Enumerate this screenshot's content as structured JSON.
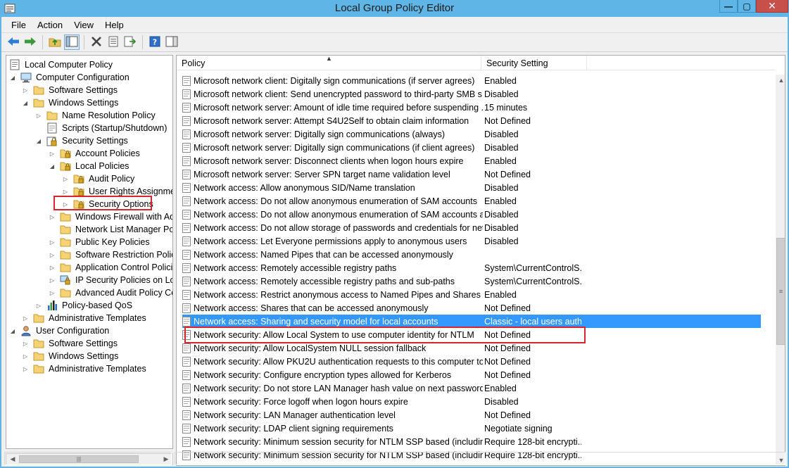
{
  "window": {
    "title": "Local Group Policy Editor"
  },
  "menubar": [
    {
      "label": "File"
    },
    {
      "label": "Action"
    },
    {
      "label": "View"
    },
    {
      "label": "Help"
    }
  ],
  "toolbar": [
    {
      "icon": "back-arrow-icon"
    },
    {
      "icon": "forward-arrow-icon"
    },
    {
      "icon": "up-folder-icon"
    },
    {
      "icon": "show-hide-tree-icon"
    },
    {
      "icon": "delete-icon"
    },
    {
      "icon": "properties-icon"
    },
    {
      "icon": "export-list-icon"
    },
    {
      "icon": "help-icon"
    },
    {
      "icon": "show-action-pane-icon"
    }
  ],
  "tree": [
    {
      "label": "Local Computer Policy",
      "level": 0,
      "expander": "",
      "icon": "policy"
    },
    {
      "label": "Computer Configuration",
      "level": 0,
      "expander": "open",
      "icon": "computer"
    },
    {
      "label": "Software Settings",
      "level": 1,
      "expander": "closed",
      "icon": "folder"
    },
    {
      "label": "Windows Settings",
      "level": 1,
      "expander": "open",
      "icon": "folder"
    },
    {
      "label": "Name Resolution Policy",
      "level": 2,
      "expander": "closed",
      "icon": "folder"
    },
    {
      "label": "Scripts (Startup/Shutdown)",
      "level": 2,
      "expander": "",
      "icon": "script"
    },
    {
      "label": "Security Settings",
      "level": 2,
      "expander": "open",
      "icon": "security"
    },
    {
      "label": "Account Policies",
      "level": 3,
      "expander": "closed",
      "icon": "lockfolder"
    },
    {
      "label": "Local Policies",
      "level": 3,
      "expander": "open",
      "icon": "lockfolder"
    },
    {
      "label": "Audit Policy",
      "level": 4,
      "expander": "closed",
      "icon": "lockfolder"
    },
    {
      "label": "User Rights Assignment",
      "level": 4,
      "expander": "closed",
      "icon": "lockfolder"
    },
    {
      "label": "Security Options",
      "level": 4,
      "expander": "closed",
      "icon": "lockfolder",
      "highlighted": true
    },
    {
      "label": "Windows Firewall with Adv",
      "level": 3,
      "expander": "closed",
      "icon": "folder"
    },
    {
      "label": "Network List Manager Polic",
      "level": 3,
      "expander": "",
      "icon": "folder"
    },
    {
      "label": "Public Key Policies",
      "level": 3,
      "expander": "closed",
      "icon": "folder"
    },
    {
      "label": "Software Restriction Policie",
      "level": 3,
      "expander": "closed",
      "icon": "folder"
    },
    {
      "label": "Application Control Policie",
      "level": 3,
      "expander": "closed",
      "icon": "folder"
    },
    {
      "label": "IP Security Policies on Loca",
      "level": 3,
      "expander": "closed",
      "icon": "ipsec"
    },
    {
      "label": "Advanced Audit Policy Cor",
      "level": 3,
      "expander": "closed",
      "icon": "folder"
    },
    {
      "label": "Policy-based QoS",
      "level": 2,
      "expander": "closed",
      "icon": "chart"
    },
    {
      "label": "Administrative Templates",
      "level": 1,
      "expander": "closed",
      "icon": "folder"
    },
    {
      "label": "User Configuration",
      "level": 0,
      "expander": "open",
      "icon": "user"
    },
    {
      "label": "Software Settings",
      "level": 1,
      "expander": "closed",
      "icon": "folder"
    },
    {
      "label": "Windows Settings",
      "level": 1,
      "expander": "closed",
      "icon": "folder"
    },
    {
      "label": "Administrative Templates",
      "level": 1,
      "expander": "closed",
      "icon": "folder"
    }
  ],
  "list": {
    "columns": [
      {
        "label": "Policy"
      },
      {
        "label": "Security Setting"
      }
    ],
    "rows": [
      {
        "policy": "Microsoft network client: Digitally sign communications (if server agrees)",
        "setting": "Enabled"
      },
      {
        "policy": "Microsoft network client: Send unencrypted password to third-party SMB s...",
        "setting": "Disabled"
      },
      {
        "policy": "Microsoft network server: Amount of idle time required before suspending ...",
        "setting": "15 minutes"
      },
      {
        "policy": "Microsoft network server: Attempt S4U2Self to obtain claim information",
        "setting": "Not Defined"
      },
      {
        "policy": "Microsoft network server: Digitally sign communications (always)",
        "setting": "Disabled"
      },
      {
        "policy": "Microsoft network server: Digitally sign communications (if client agrees)",
        "setting": "Disabled"
      },
      {
        "policy": "Microsoft network server: Disconnect clients when logon hours expire",
        "setting": "Enabled"
      },
      {
        "policy": "Microsoft network server: Server SPN target name validation level",
        "setting": "Not Defined"
      },
      {
        "policy": "Network access: Allow anonymous SID/Name translation",
        "setting": "Disabled"
      },
      {
        "policy": "Network access: Do not allow anonymous enumeration of SAM accounts",
        "setting": "Enabled"
      },
      {
        "policy": "Network access: Do not allow anonymous enumeration of SAM accounts a...",
        "setting": "Disabled"
      },
      {
        "policy": "Network access: Do not allow storage of passwords and credentials for net...",
        "setting": "Disabled"
      },
      {
        "policy": "Network access: Let Everyone permissions apply to anonymous users",
        "setting": "Disabled"
      },
      {
        "policy": "Network access: Named Pipes that can be accessed anonymously",
        "setting": ""
      },
      {
        "policy": "Network access: Remotely accessible registry paths",
        "setting": "System\\CurrentControlS..."
      },
      {
        "policy": "Network access: Remotely accessible registry paths and sub-paths",
        "setting": "System\\CurrentControlS..."
      },
      {
        "policy": "Network access: Restrict anonymous access to Named Pipes and Shares",
        "setting": "Enabled"
      },
      {
        "policy": "Network access: Shares that can be accessed anonymously",
        "setting": "Not Defined"
      },
      {
        "policy": "Network access: Sharing and security model for local accounts",
        "setting": "Classic - local users auth...",
        "selected": true
      },
      {
        "policy": "Network security: Allow Local System to use computer identity for NTLM",
        "setting": "Not Defined"
      },
      {
        "policy": "Network security: Allow LocalSystem NULL session fallback",
        "setting": "Not Defined"
      },
      {
        "policy": "Network security: Allow PKU2U authentication requests to this computer to...",
        "setting": "Not Defined"
      },
      {
        "policy": "Network security: Configure encryption types allowed for Kerberos",
        "setting": "Not Defined"
      },
      {
        "policy": "Network security: Do not store LAN Manager hash value on next password ...",
        "setting": "Enabled"
      },
      {
        "policy": "Network security: Force logoff when logon hours expire",
        "setting": "Disabled"
      },
      {
        "policy": "Network security: LAN Manager authentication level",
        "setting": "Not Defined"
      },
      {
        "policy": "Network security: LDAP client signing requirements",
        "setting": "Negotiate signing"
      },
      {
        "policy": "Network security: Minimum session security for NTLM SSP based (includin...",
        "setting": "Require 128-bit encrypti..."
      },
      {
        "policy": "Network security: Minimum session security for NTLM SSP based (includin...",
        "setting": "Require 128-bit encrypti..."
      }
    ]
  },
  "colors": {
    "title_bar": "#5fb5e6",
    "selection": "#3399ff",
    "highlight_box": "#d9262e"
  }
}
